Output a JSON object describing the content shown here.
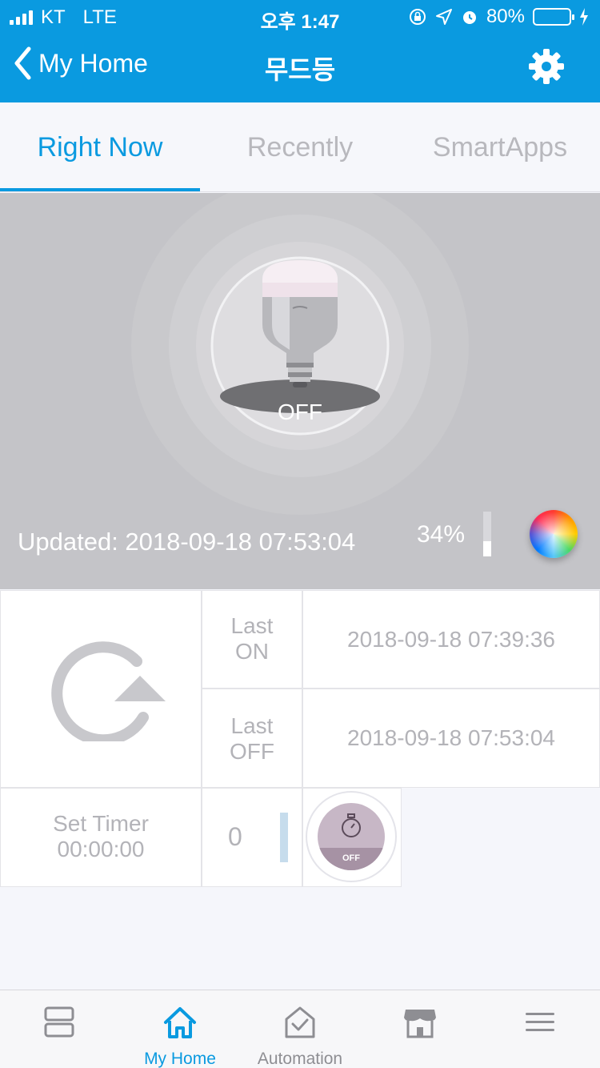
{
  "status": {
    "carrier": "KT",
    "network": "LTE",
    "time": "오후 1:47",
    "battery": "80%",
    "battery_level": 0.8
  },
  "nav": {
    "back_label": "My Home",
    "title": "무드등",
    "settings_icon": "gear-icon"
  },
  "tabs": [
    {
      "label": "Right Now",
      "active": true
    },
    {
      "label": "Recently",
      "active": false
    },
    {
      "label": "SmartApps",
      "active": false
    }
  ],
  "device": {
    "state": "OFF",
    "updated": "Updated: 2018-09-18 07:53:04",
    "brightness": "34%",
    "brightness_level": 0.34
  },
  "history": {
    "refresh_icon": "refresh-icon",
    "last_on_label": "Last\nON",
    "last_on_time": "2018-09-18 07:39:36",
    "last_off_label": "Last\nOFF",
    "last_off_time": "2018-09-18 07:53:04"
  },
  "timer": {
    "label": "Set Timer",
    "value": "00:00:00",
    "count": "0",
    "button_state": "OFF"
  },
  "bottom_nav": [
    {
      "label": "",
      "icon": "dashboard-icon",
      "active": false
    },
    {
      "label": "My Home",
      "icon": "home-icon",
      "active": true
    },
    {
      "label": "Automation",
      "icon": "automation-icon",
      "active": false
    },
    {
      "label": "",
      "icon": "store-icon",
      "active": false
    },
    {
      "label": "",
      "icon": "menu-icon",
      "active": false
    }
  ],
  "colors": {
    "accent": "#0a9ae0",
    "hero_bg": "#c4c4c8",
    "muted_text": "#b3b3b8"
  }
}
